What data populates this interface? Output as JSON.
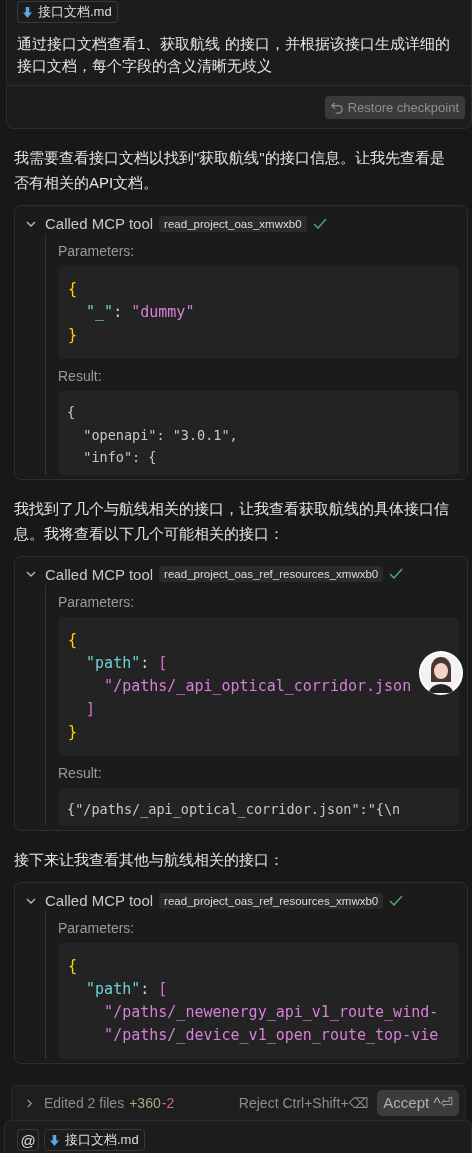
{
  "user_message": {
    "attachment": "接口文档.md",
    "text": "通过接口文档查看1、获取航线 的接口，并根据该接口生成详细的接口文档，每个字段的含义清晰无歧义",
    "restore_button": "Restore checkpoint"
  },
  "conversation": [
    {
      "kind": "text",
      "text": "我需要查看接口文档以找到\"获取航线\"的接口信息。让我先查看是否有相关的API文档。"
    },
    {
      "kind": "tool_call",
      "label": "Called MCP tool",
      "tool": "read_project_oas_xmwxb0",
      "succeeded": true,
      "expanded": true,
      "parameters_label": "Parameters:",
      "parameters": [
        [
          {
            "kind": "brace",
            "text": "{"
          }
        ],
        [
          {
            "kind": "key",
            "text": "  \"_\""
          },
          {
            "kind": "punct",
            "text": ": "
          },
          {
            "kind": "string",
            "text": "\"dummy\""
          }
        ],
        [
          {
            "kind": "brace",
            "text": "}"
          }
        ]
      ],
      "result_label": "Result:",
      "result": [
        "{",
        "  \"openapi\": \"3.0.1\",",
        "  \"info\": {"
      ]
    },
    {
      "kind": "text",
      "text": "我找到了几个与航线相关的接口，让我查看获取航线的具体接口信息。我将查看以下几个可能相关的接口："
    },
    {
      "kind": "tool_call",
      "label": "Called MCP tool",
      "tool": "read_project_oas_ref_resources_xmwxb0",
      "succeeded": true,
      "expanded": true,
      "avatar": true,
      "parameters_label": "Parameters:",
      "parameters": [
        [
          {
            "kind": "brace",
            "text": "{"
          }
        ],
        [
          {
            "kind": "key",
            "text": "  \"path\""
          },
          {
            "kind": "punct",
            "text": ": "
          },
          {
            "kind": "bracket",
            "text": "["
          }
        ],
        [
          {
            "kind": "string",
            "text": "    \"/paths/_api_optical_corridor.json"
          }
        ],
        [
          {
            "kind": "bracket",
            "text": "  ]"
          }
        ],
        [
          {
            "kind": "brace",
            "text": "}"
          }
        ]
      ],
      "result_label": "Result:",
      "result": [
        "{\"/paths/_api_optical_corridor.json\":\"{\\n"
      ]
    },
    {
      "kind": "text",
      "text": "接下来让我查看其他与航线相关的接口："
    },
    {
      "kind": "tool_call",
      "label": "Called MCP tool",
      "tool": "read_project_oas_ref_resources_xmwxb0",
      "succeeded": true,
      "expanded": true,
      "parameters_label": "Parameters:",
      "parameters": [
        [
          {
            "kind": "brace",
            "text": "{"
          }
        ],
        [
          {
            "kind": "key",
            "text": "  \"path\""
          },
          {
            "kind": "punct",
            "text": ": "
          },
          {
            "kind": "bracket",
            "text": "["
          }
        ],
        [
          {
            "kind": "string",
            "text": "    \"/paths/_newenergy_api_v1_route_wind-"
          }
        ],
        [
          {
            "kind": "string",
            "text": "    \"/paths/_device_v1_open_route_top-vie"
          }
        ]
      ]
    }
  ],
  "review_bar": {
    "expanded": false,
    "summary": "Edited 2 files",
    "added": "+360",
    "removed": "-2",
    "reject": "Reject Ctrl+Shift+⌫",
    "accept": "Accept ^⏎"
  },
  "composer": {
    "mention_button": "@",
    "attachment": "接口文档.md"
  }
}
